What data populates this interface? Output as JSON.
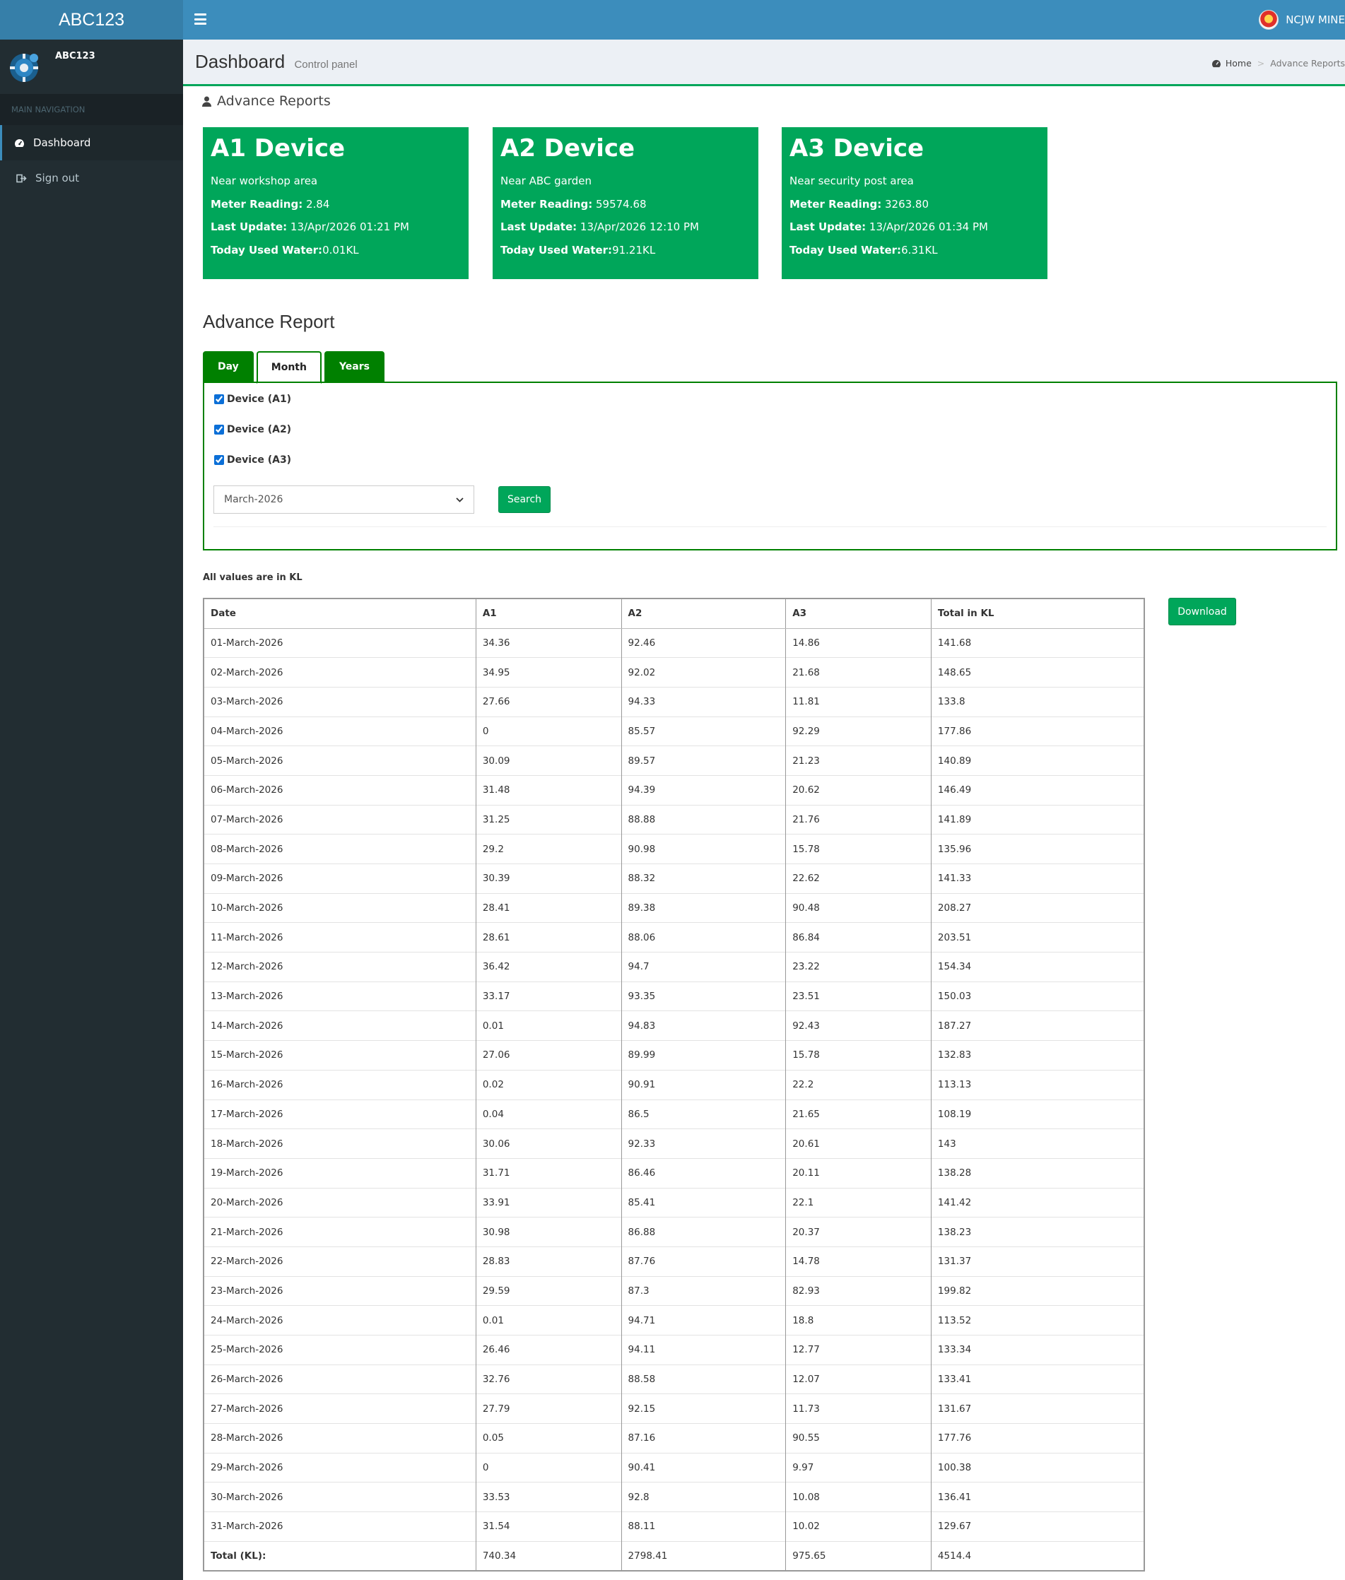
{
  "app": {
    "logo_text": "ABC123",
    "user_name": "NCJW MINE"
  },
  "sidebar": {
    "user": "ABC123",
    "nav_header": "MAIN NAVIGATION",
    "items": [
      {
        "label": "Dashboard",
        "icon": "dashboard-icon"
      },
      {
        "label": "Sign out",
        "icon": "sign-out-icon"
      }
    ]
  },
  "header": {
    "title": "Dashboard",
    "subtitle": "Control panel",
    "breadcrumb": [
      "Home",
      "Advance Reports"
    ]
  },
  "box": {
    "title": "Advance Reports"
  },
  "devices": [
    {
      "name": "A1 Device",
      "location": "Near workshop area",
      "meter_label": "Meter Reading:",
      "meter": "2.84",
      "update_label": "Last Update:",
      "update": "13/Apr/2026 01:21 PM",
      "today_label": "Today Used Water:",
      "today": "0.01KL"
    },
    {
      "name": "A2 Device",
      "location": "Near ABC garden",
      "meter_label": "Meter Reading:",
      "meter": "59574.68",
      "update_label": "Last Update:",
      "update": "13/Apr/2026 12:10 PM",
      "today_label": "Today Used Water:",
      "today": "91.21KL"
    },
    {
      "name": "A3 Device",
      "location": "Near security post area",
      "meter_label": "Meter Reading:",
      "meter": "3263.80",
      "update_label": "Last Update:",
      "update": "13/Apr/2026 01:34 PM",
      "today_label": "Today Used Water:",
      "today": "6.31KL"
    }
  ],
  "report": {
    "title": "Advance Report",
    "tabs": [
      "Day",
      "Month",
      "Years"
    ],
    "active_tab": "Month",
    "checkboxes": [
      {
        "label": "Device (A1)",
        "checked": true
      },
      {
        "label": "Device (A2)",
        "checked": true
      },
      {
        "label": "Device (A3)",
        "checked": true
      }
    ],
    "month_select": "March-2026",
    "search_label": "Search",
    "values_note": "All values are in KL",
    "download_label": "Download",
    "columns": [
      "Date",
      "A1",
      "A2",
      "A3",
      "Total in KL"
    ],
    "rows": [
      [
        "01-March-2026",
        "34.36",
        "92.46",
        "14.86",
        "141.68"
      ],
      [
        "02-March-2026",
        "34.95",
        "92.02",
        "21.68",
        "148.65"
      ],
      [
        "03-March-2026",
        "27.66",
        "94.33",
        "11.81",
        "133.8"
      ],
      [
        "04-March-2026",
        "0",
        "85.57",
        "92.29",
        "177.86"
      ],
      [
        "05-March-2026",
        "30.09",
        "89.57",
        "21.23",
        "140.89"
      ],
      [
        "06-March-2026",
        "31.48",
        "94.39",
        "20.62",
        "146.49"
      ],
      [
        "07-March-2026",
        "31.25",
        "88.88",
        "21.76",
        "141.89"
      ],
      [
        "08-March-2026",
        "29.2",
        "90.98",
        "15.78",
        "135.96"
      ],
      [
        "09-March-2026",
        "30.39",
        "88.32",
        "22.62",
        "141.33"
      ],
      [
        "10-March-2026",
        "28.41",
        "89.38",
        "90.48",
        "208.27"
      ],
      [
        "11-March-2026",
        "28.61",
        "88.06",
        "86.84",
        "203.51"
      ],
      [
        "12-March-2026",
        "36.42",
        "94.7",
        "23.22",
        "154.34"
      ],
      [
        "13-March-2026",
        "33.17",
        "93.35",
        "23.51",
        "150.03"
      ],
      [
        "14-March-2026",
        "0.01",
        "94.83",
        "92.43",
        "187.27"
      ],
      [
        "15-March-2026",
        "27.06",
        "89.99",
        "15.78",
        "132.83"
      ],
      [
        "16-March-2026",
        "0.02",
        "90.91",
        "22.2",
        "113.13"
      ],
      [
        "17-March-2026",
        "0.04",
        "86.5",
        "21.65",
        "108.19"
      ],
      [
        "18-March-2026",
        "30.06",
        "92.33",
        "20.61",
        "143"
      ],
      [
        "19-March-2026",
        "31.71",
        "86.46",
        "20.11",
        "138.28"
      ],
      [
        "20-March-2026",
        "33.91",
        "85.41",
        "22.1",
        "141.42"
      ],
      [
        "21-March-2026",
        "30.98",
        "86.88",
        "20.37",
        "138.23"
      ],
      [
        "22-March-2026",
        "28.83",
        "87.76",
        "14.78",
        "131.37"
      ],
      [
        "23-March-2026",
        "29.59",
        "87.3",
        "82.93",
        "199.82"
      ],
      [
        "24-March-2026",
        "0.01",
        "94.71",
        "18.8",
        "113.52"
      ],
      [
        "25-March-2026",
        "26.46",
        "94.11",
        "12.77",
        "133.34"
      ],
      [
        "26-March-2026",
        "32.76",
        "88.58",
        "12.07",
        "133.41"
      ],
      [
        "27-March-2026",
        "27.79",
        "92.15",
        "11.73",
        "131.67"
      ],
      [
        "28-March-2026",
        "0.05",
        "87.16",
        "90.55",
        "177.76"
      ],
      [
        "29-March-2026",
        "0",
        "90.41",
        "9.97",
        "100.38"
      ],
      [
        "30-March-2026",
        "33.53",
        "92.8",
        "10.08",
        "136.41"
      ],
      [
        "31-March-2026",
        "31.54",
        "88.11",
        "10.02",
        "129.67"
      ]
    ],
    "total_row": [
      "Total (KL):",
      "740.34",
      "2798.41",
      "975.65",
      "4514.4"
    ]
  },
  "colors": {
    "header": "#3c8dbc",
    "logo_bar": "#367fa9",
    "sidebar": "#222d32",
    "accent_green": "#00a65a",
    "tab_green": "#008000"
  }
}
